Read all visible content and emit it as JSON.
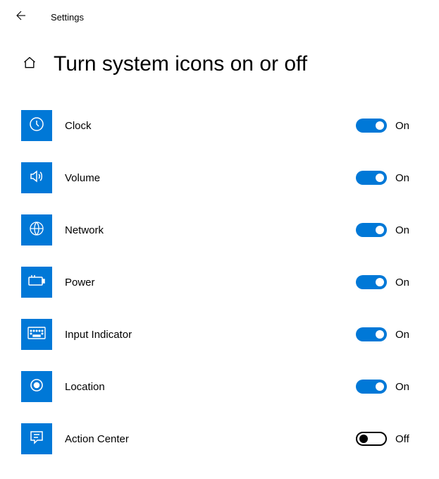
{
  "app_title": "Settings",
  "page_title": "Turn system icons on or off",
  "state_on": "On",
  "state_off": "Off",
  "items": [
    {
      "label": "Clock",
      "on": true
    },
    {
      "label": "Volume",
      "on": true
    },
    {
      "label": "Network",
      "on": true
    },
    {
      "label": "Power",
      "on": true
    },
    {
      "label": "Input Indicator",
      "on": true
    },
    {
      "label": "Location",
      "on": true
    },
    {
      "label": "Action Center",
      "on": false
    }
  ]
}
